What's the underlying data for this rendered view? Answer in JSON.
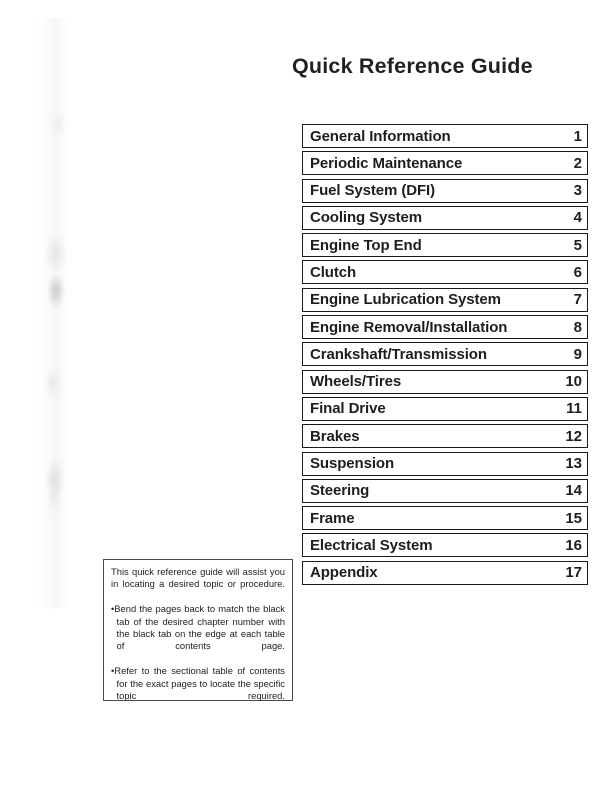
{
  "page": {
    "title": "Quick Reference Guide"
  },
  "chapter_index": {
    "rows": [
      {
        "name": "General Information",
        "number": "1"
      },
      {
        "name": "Periodic Maintenance",
        "number": "2"
      },
      {
        "name": "Fuel System (DFI)",
        "number": "3"
      },
      {
        "name": "Cooling System",
        "number": "4"
      },
      {
        "name": "Engine Top End",
        "number": "5"
      },
      {
        "name": "Clutch",
        "number": "6"
      },
      {
        "name": "Engine Lubrication System",
        "number": "7"
      },
      {
        "name": "Engine Removal/Installation",
        "number": "8"
      },
      {
        "name": "Crankshaft/Transmission",
        "number": "9"
      },
      {
        "name": "Wheels/Tires",
        "number": "10"
      },
      {
        "name": "Final Drive",
        "number": "11"
      },
      {
        "name": "Brakes",
        "number": "12"
      },
      {
        "name": "Suspension",
        "number": "13"
      },
      {
        "name": "Steering",
        "number": "14"
      },
      {
        "name": "Frame",
        "number": "15"
      },
      {
        "name": "Electrical System",
        "number": "16"
      },
      {
        "name": "Appendix",
        "number": "17"
      }
    ]
  },
  "note_box": {
    "intro": "This quick reference guide will assist you in locating a desired topic or procedure.",
    "bullets": [
      "Bend the pages back to match the black tab of the desired chapter number with the black tab on the edge at each table of contents page.",
      "Refer to the sectional table of contents for the exact pages to locate the specific topic required."
    ],
    "bullet_marker": "•"
  },
  "colors": {
    "page_background": "#ffffff",
    "ink": "#201d1e",
    "row_border": "#1c1a1b",
    "note_border": "#4a4a4d"
  }
}
